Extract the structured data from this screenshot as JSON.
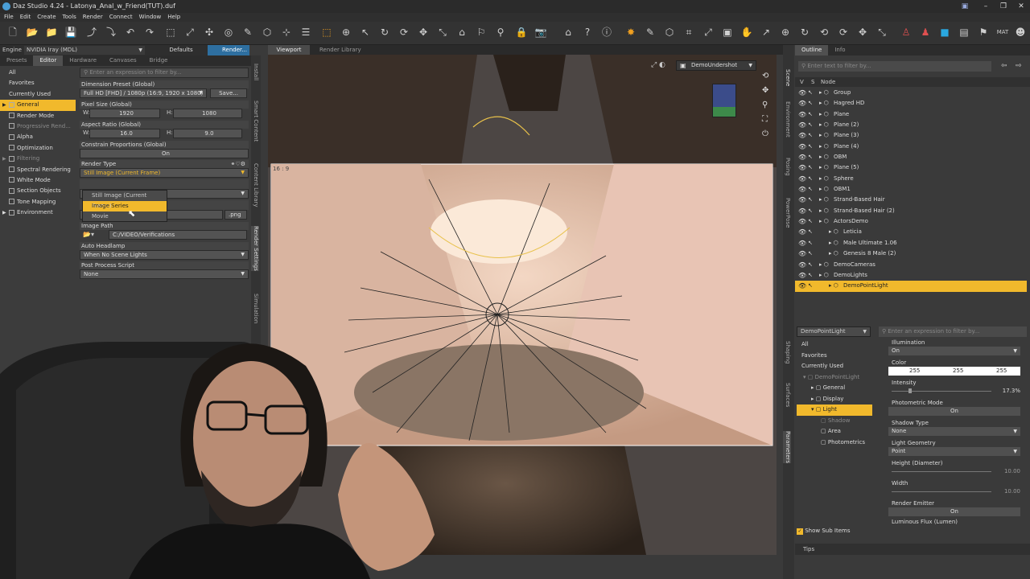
{
  "titlebar": {
    "title": "Daz Studio 4.24 - Latonya_Anal_w_Friend(TUT).duf"
  },
  "menu": [
    "File",
    "Edit",
    "Create",
    "Tools",
    "Render",
    "Connect",
    "Window",
    "Help"
  ],
  "engine": {
    "label": "Engine :",
    "value": "NVIDIA Iray (MDL)",
    "defaults": "Defaults",
    "render": "Render..."
  },
  "left_tabs": [
    "Presets",
    "Editor",
    "Hardware",
    "Canvases",
    "Bridge"
  ],
  "left_categories": [
    {
      "label": "All",
      "state": "normal",
      "box": false
    },
    {
      "label": "Favorites",
      "state": "normal",
      "box": false
    },
    {
      "label": "Currently Used",
      "state": "normal",
      "box": false
    },
    {
      "label": "General",
      "state": "sel",
      "box": true
    },
    {
      "label": "Render Mode",
      "state": "normal",
      "box": true
    },
    {
      "label": "Progressive Rend...",
      "state": "dim",
      "box": true
    },
    {
      "label": "Alpha",
      "state": "normal",
      "box": true
    },
    {
      "label": "Optimization",
      "state": "normal",
      "box": true
    },
    {
      "label": "Filtering",
      "state": "dim",
      "box": true
    },
    {
      "label": "Spectral Rendering",
      "state": "normal",
      "box": true
    },
    {
      "label": "White Mode",
      "state": "normal",
      "box": true
    },
    {
      "label": "Section Objects",
      "state": "normal",
      "box": true
    },
    {
      "label": "Tone Mapping",
      "state": "normal",
      "box": true
    },
    {
      "label": "Environment",
      "state": "normal",
      "box": true
    }
  ],
  "settings": {
    "filter_placeholder": "Enter an expression to filter by...",
    "dimension_preset_label": "Dimension Preset (Global)",
    "dimension_preset_value": "Full HD [FHD] / 1080p (16:9, 1920 x 1080)",
    "save_label": "Save...",
    "pixel_size_label": "Pixel Size (Global)",
    "pixel_w_label": "W:",
    "pixel_w": "1920",
    "pixel_h_label": "H:",
    "pixel_h": "1080",
    "aspect_ratio_label": "Aspect Ratio (Global)",
    "aspect_w_label": "W:",
    "aspect_w": "16.0",
    "aspect_h_label": "H:",
    "aspect_h": "9.0",
    "constrain_label": "Constrain Proportions (Global)",
    "constrain_value": "On",
    "render_type_label": "Render Type",
    "render_type_value": "Still Image (Current Frame)",
    "image_name_placeholder": "Enter a name for the image",
    "image_ext": ".png",
    "image_path_label": "Image Path",
    "image_path_value": "C:/VIDEO/Verifications",
    "auto_headlamp_label": "Auto Headlamp",
    "auto_headlamp_value": "When No Scene Lights",
    "post_process_label": "Post Process Script",
    "post_process_value": "None"
  },
  "render_type_options": [
    "Still Image (Current Frame)",
    "Image Series",
    "Movie"
  ],
  "left_vertical_tabs": [
    "Install",
    "Smart Content",
    "Content Library",
    "Render Settings",
    "Simulation"
  ],
  "viewport": {
    "tabs": [
      "Viewport",
      "Render Library"
    ],
    "camera": "DemoUndershot",
    "aspect_label": "16 : 9"
  },
  "scene_tabs": [
    "Outline",
    "Info"
  ],
  "scene": {
    "filter_placeholder": "Enter text to filter by...",
    "col_v": "V",
    "col_s": "S",
    "col_node": "Node",
    "nodes": [
      {
        "label": "Group",
        "indent": 0,
        "sel": false
      },
      {
        "label": "Hagred HD",
        "indent": 0,
        "sel": false
      },
      {
        "label": "Plane",
        "indent": 0,
        "sel": false
      },
      {
        "label": "Plane (2)",
        "indent": 0,
        "sel": false
      },
      {
        "label": "Plane (3)",
        "indent": 0,
        "sel": false
      },
      {
        "label": "Plane (4)",
        "indent": 0,
        "sel": false
      },
      {
        "label": "OBM",
        "indent": 0,
        "sel": false
      },
      {
        "label": "Plane (5)",
        "indent": 0,
        "sel": false
      },
      {
        "label": "Sphere",
        "indent": 0,
        "sel": false
      },
      {
        "label": "OBM1",
        "indent": 0,
        "sel": false
      },
      {
        "label": "Strand-Based Hair",
        "indent": 0,
        "sel": false
      },
      {
        "label": "Strand-Based Hair (2)",
        "indent": 0,
        "sel": false
      },
      {
        "label": "ActorsDemo",
        "indent": 0,
        "sel": false
      },
      {
        "label": "Leticia",
        "indent": 1,
        "sel": false
      },
      {
        "label": "Male Ultimate 1.06",
        "indent": 1,
        "sel": false
      },
      {
        "label": "Genesis 8 Male (2)",
        "indent": 1,
        "sel": false
      },
      {
        "label": "DemoCameras",
        "indent": 0,
        "sel": false
      },
      {
        "label": "DemoLights",
        "indent": 0,
        "sel": false
      },
      {
        "label": "DemoPointLight",
        "indent": 1,
        "sel": true
      }
    ]
  },
  "right_vertical_tabs": [
    "Scene",
    "Environment",
    "Posing",
    "PowerPose",
    "Shaping",
    "Surfaces",
    "Parameters"
  ],
  "params": {
    "node_select": "DemoPointLight",
    "filter_placeholder": "Enter an expression to filter by...",
    "categories": [
      {
        "label": "All",
        "state": "normal"
      },
      {
        "label": "Favorites",
        "state": "normal"
      },
      {
        "label": "Currently Used",
        "state": "normal"
      },
      {
        "label": "DemoPointLight",
        "state": "dim"
      },
      {
        "label": "General",
        "state": "normal"
      },
      {
        "label": "Display",
        "state": "normal"
      },
      {
        "label": "Light",
        "state": "sel"
      },
      {
        "label": "Shadow",
        "state": "dim"
      },
      {
        "label": "Area",
        "state": "normal"
      },
      {
        "label": "Photometrics",
        "state": "normal"
      }
    ],
    "show_sub_items": "Show Sub Items",
    "illumination_label": "Illumination",
    "illumination_value": "On",
    "color_label": "Color",
    "color_r": "255",
    "color_g": "255",
    "color_b": "255",
    "intensity_label": "Intensity",
    "intensity_value": "17.3%",
    "intensity_level": 0.173,
    "photometric_label": "Photometric Mode",
    "photometric_value": "On",
    "shadow_type_label": "Shadow Type",
    "shadow_type_value": "None",
    "light_geometry_label": "Light Geometry",
    "light_geometry_value": "Point",
    "height_label": "Height (Diameter)",
    "height_value": "10.00",
    "width_label": "Width",
    "width_value": "10.00",
    "render_emitter_label": "Render Emitter",
    "render_emitter_value": "On",
    "luminous_label": "Luminous Flux (Lumen)"
  },
  "tips_label": "Tips",
  "colors": {
    "accent": "#f1b92c",
    "panel": "#3c3c3c",
    "viewport_bg": "#4a4a4a"
  }
}
